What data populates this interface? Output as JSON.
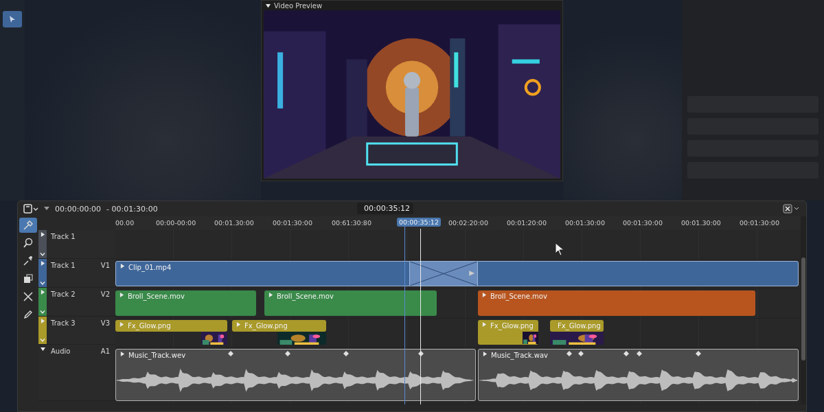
{
  "preview": {
    "title": "Video Preview",
    "expanded": true
  },
  "timeline": {
    "range_start": "00:00:00:00",
    "range_end": "- 00:01:30:00",
    "current_time": "00:00:35:12",
    "ruler": [
      "00.00",
      "00:00-00:00",
      "00:01.30:00",
      "00:01:30:00",
      "00:61:30:80",
      "00:02:20:00",
      "00:01:20:00",
      "00:01:30:00",
      "00:01:30:00",
      "00:01.30:00",
      "00:01:30:00"
    ],
    "playhead": "00:00:35:12",
    "tools": [
      {
        "kind": "eyedropper",
        "selected": true
      },
      {
        "kind": "zoom",
        "selected": false
      },
      {
        "kind": "picker",
        "selected": false
      },
      {
        "kind": "box",
        "selected": false
      },
      {
        "kind": "blade",
        "selected": false
      },
      {
        "kind": "pencil",
        "selected": false
      }
    ],
    "tracks": [
      {
        "name": "Track 1",
        "kind": "video",
        "expanded": false,
        "color": "#4a4f58"
      },
      {
        "name": "Track 1",
        "channel": "V1",
        "kind": "video",
        "expanded": false,
        "color": "#3f6699",
        "clips": [
          {
            "name": "Clip_01.mp4",
            "kind": "block",
            "color": "#3f6699"
          },
          {
            "kind": "transition",
            "color": "#6a8cbc"
          }
        ]
      },
      {
        "name": "Track 2",
        "channel": "V2",
        "kind": "video",
        "expanded": false,
        "color": "#3a8a4a",
        "clips": [
          {
            "name": "Broll_Scene.mov",
            "kind": "block",
            "color": "#3a8a4a"
          },
          {
            "name": "Broll_Scene.mov",
            "kind": "block",
            "color": "#3a8a4a"
          },
          {
            "name": "Broll_Scene.mov",
            "kind": "block",
            "color": "#b8551f"
          }
        ]
      },
      {
        "name": "Track 3",
        "channel": "V3",
        "kind": "video",
        "expanded": false,
        "color": "#a99a2a",
        "clips": [
          {
            "name": "Fx_Glow.png",
            "kind": "header",
            "color": "#a99a2a"
          },
          {
            "name": "Fx_Glow.png",
            "kind": "header",
            "color": "#a99a2a"
          },
          {
            "name": "Fx_Glow.png",
            "kind": "block",
            "color": "#a99a2a"
          },
          {
            "name": "Fx_Glow.png",
            "kind": "header",
            "color": "#a99a2a"
          }
        ]
      },
      {
        "name": "Audio",
        "channel": "A1",
        "kind": "audio",
        "expanded": true,
        "clips": [
          {
            "name": "Music_Track.wev",
            "kind": "audio",
            "color": "#4b4b4b"
          },
          {
            "name": "Music_Track.wav",
            "kind": "audio",
            "color": "#4b4b4b"
          }
        ]
      }
    ]
  }
}
